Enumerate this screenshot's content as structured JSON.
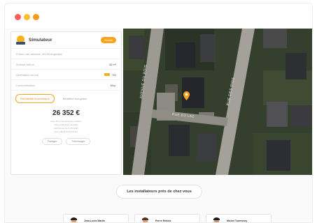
{
  "app": {
    "title": "Simulateur",
    "badge": "Gratuit"
  },
  "form": {
    "address_placeholder": "Entrez une adresse, 40150 Angresse",
    "rows": [
      {
        "label": "Surface toiture",
        "value": "40 m²"
      },
      {
        "label": "Orientation du toit",
        "value": "SO"
      },
      {
        "label": "Consommation",
        "value": "Moy."
      }
    ]
  },
  "tabs": [
    {
      "label": "Rentabilité économique",
      "active": true
    },
    {
      "label": "Bénéfice éco-gains",
      "active": false
    }
  ],
  "result": {
    "price": "26 352 €",
    "description_line1": "Avec 40 m² de panneaux solaires",
    "description_line2": "votre production annuelle",
    "description_line3": "estimée est de 6 270 kWh",
    "description_line4": "soit 1 290 € d'économies"
  },
  "result_buttons": [
    "Partager",
    "Télécharger"
  ],
  "map": {
    "street_left": "AVENUE DU BOIS",
    "street_right": "RUE DES PINS",
    "street_bottom": "RUE DU LAC",
    "pin": "location-pin-icon"
  },
  "installers_cta": "Les installateurs près de chez vous",
  "installers": [
    {
      "name": "Jean-Louis Martin"
    },
    {
      "name": "Pierre Rebelo"
    },
    {
      "name": "Michel Tournesey"
    }
  ],
  "colors": {
    "accent": "#f7a21b",
    "window_dots": [
      "#ff5f57",
      "#febc2e",
      "#f79a1e"
    ]
  }
}
